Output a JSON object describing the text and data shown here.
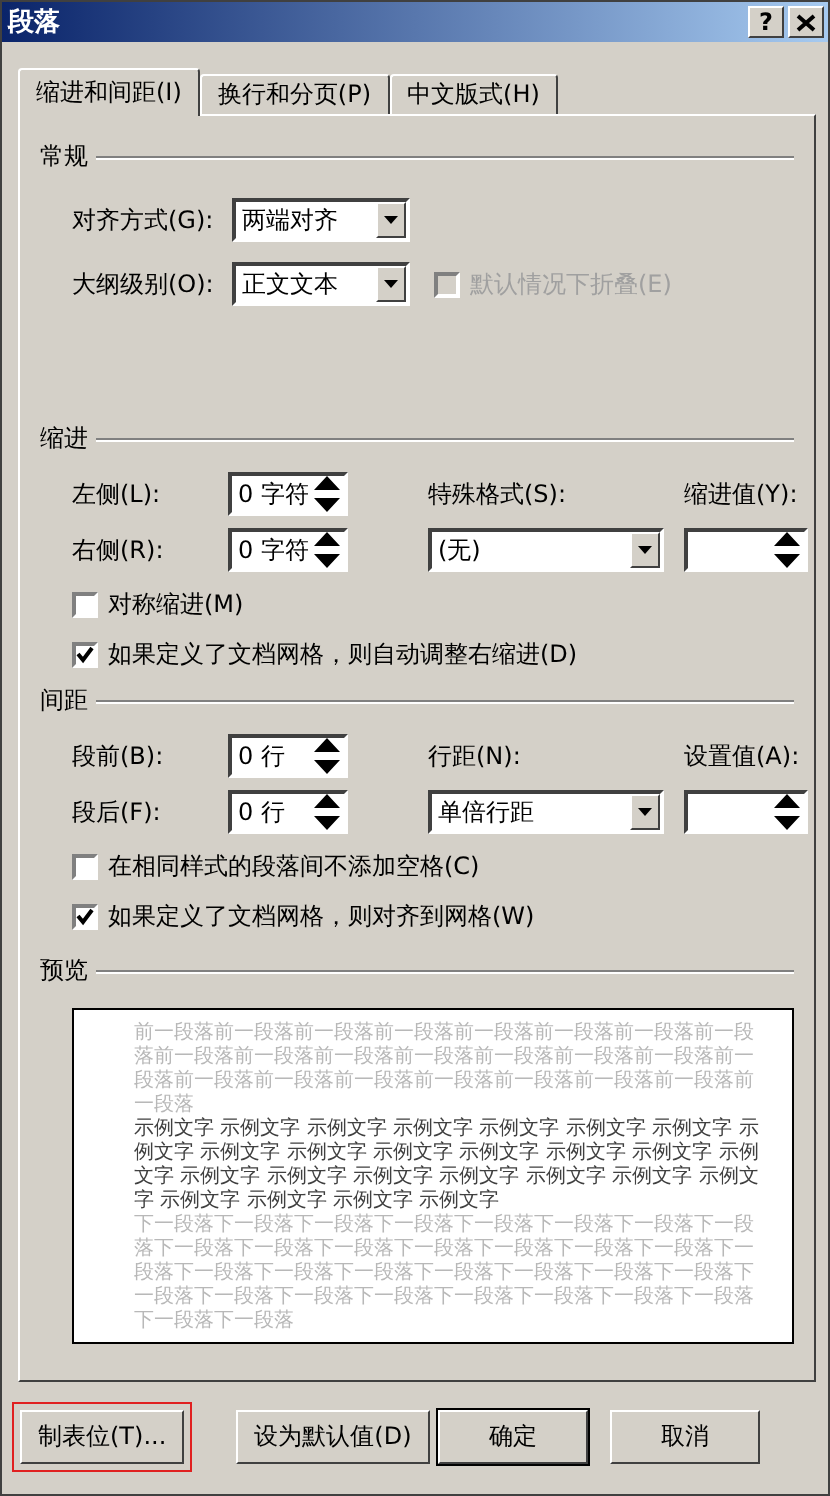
{
  "window": {
    "title": "段落",
    "help": "?"
  },
  "tabs": [
    {
      "label": "缩进和间距(I)",
      "selected": true
    },
    {
      "label": "换行和分页(P)",
      "selected": false
    },
    {
      "label": "中文版式(H)",
      "selected": false
    }
  ],
  "general": {
    "title": "常规",
    "alignment": {
      "label": "对齐方式(G):",
      "value": "两端对齐"
    },
    "outline": {
      "label": "大纲级别(O):",
      "value": "正文文本"
    },
    "collapse": {
      "label": "默认情况下折叠(E)",
      "checked": false,
      "disabled": true
    }
  },
  "indent": {
    "title": "缩进",
    "left": {
      "label": "左侧(L):",
      "value": "0 字符"
    },
    "right": {
      "label": "右侧(R):",
      "value": "0 字符"
    },
    "special": {
      "label": "特殊格式(S):",
      "value": "(无)"
    },
    "by": {
      "label": "缩进值(Y):"
    },
    "options": [
      {
        "label": "对称缩进(M)",
        "checked": false
      },
      {
        "label": "如果定义了文档网格，则自动调整右缩进(D)",
        "checked": true
      }
    ]
  },
  "spacing": {
    "title": "间距",
    "before": {
      "label": "段前(B):",
      "value": "0 行"
    },
    "after": {
      "label": "段后(F):",
      "value": "0 行"
    },
    "line": {
      "label": "行距(N):",
      "value": "单倍行距"
    },
    "at": {
      "label": "设置值(A):"
    },
    "options": [
      {
        "label": "在相同样式的段落间不添加空格(C)",
        "checked": false
      },
      {
        "label": "如果定义了文档网格，则对齐到网格(W)",
        "checked": true
      }
    ]
  },
  "preview": {
    "title": "预览",
    "previous": "前一段落前一段落前一段落前一段落前一段落前一段落前一段落前一段落前一段落前一段落前一段落前一段落前一段落前一段落前一段落前一段落前一段落前一段落前一段落前一段落前一段落前一段落前一段落前一段落",
    "sample": "示例文字 示例文字 示例文字 示例文字 示例文字 示例文字 示例文字 示例文字 示例文字 示例文字 示例文字 示例文字 示例文字 示例文字 示例文字 示例文字 示例文字 示例文字 示例文字 示例文字 示例文字 示例文字 示例文字 示例文字 示例文字 示例文字",
    "next": "下一段落下一段落下一段落下一段落下一段落下一段落下一段落下一段落下一段落下一段落下一段落下一段落下一段落下一段落下一段落下一段落下一段落下一段落下一段落下一段落下一段落下一段落下一段落下一段落下一段落下一段落下一段落下一段落下一段落下一段落下一段落下一段落下一段落"
  },
  "buttons": [
    {
      "label": "制表位(T)...",
      "highlighted": true,
      "default": false
    },
    {
      "label": "设为默认值(D)",
      "highlighted": false,
      "default": false
    },
    {
      "label": "确定",
      "highlighted": false,
      "default": true
    },
    {
      "label": "取消",
      "highlighted": false,
      "default": false
    }
  ]
}
